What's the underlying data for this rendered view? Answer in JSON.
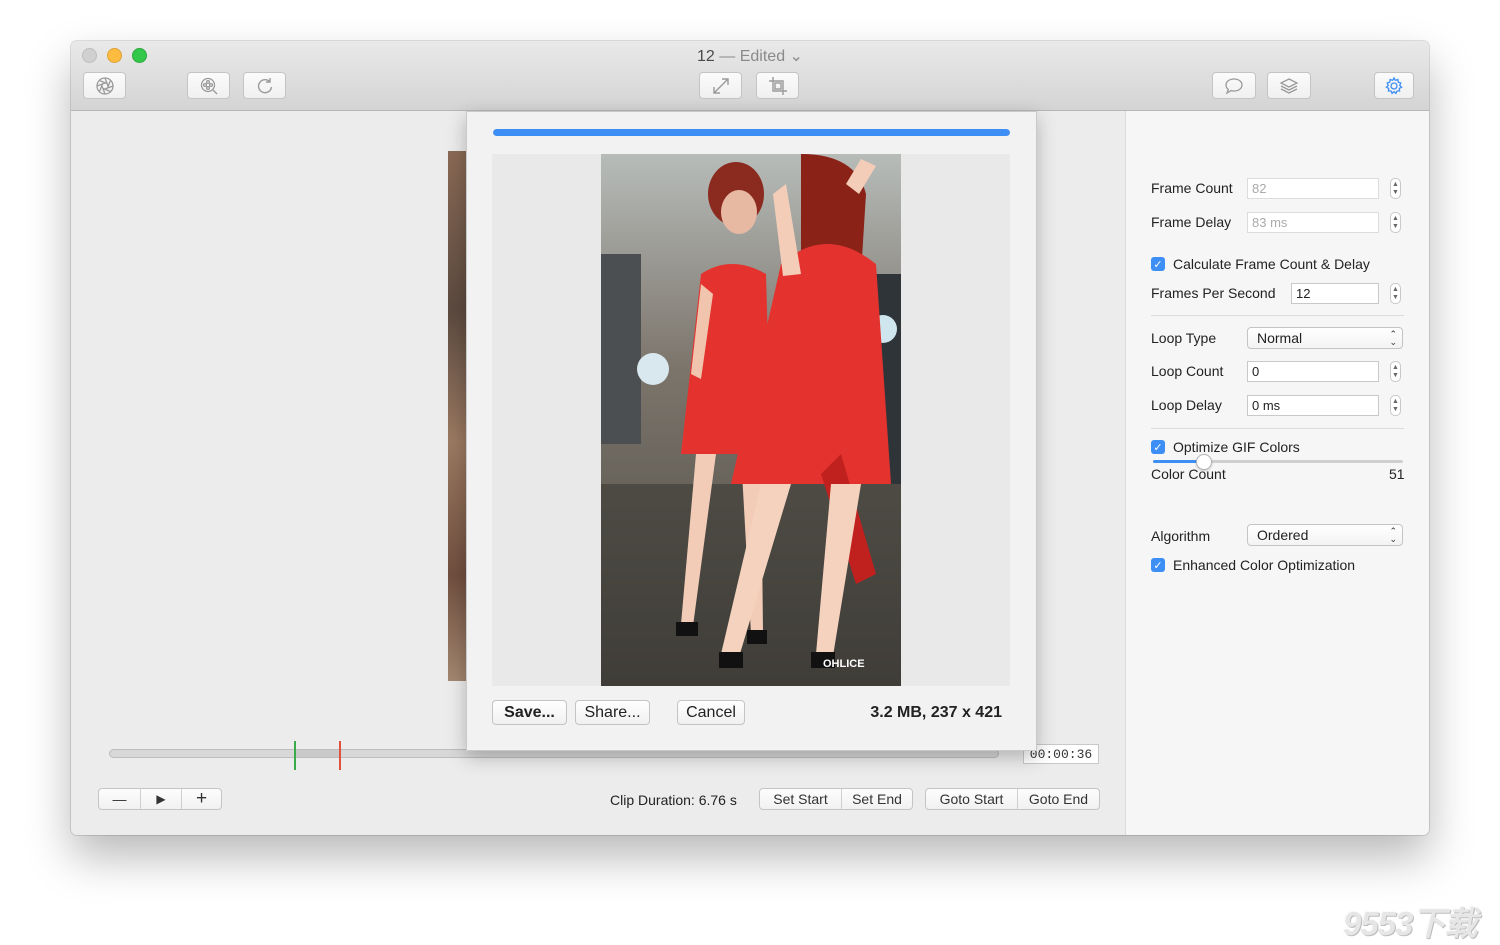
{
  "window": {
    "title": "12",
    "title_status": "— Edited",
    "title_chevron": "⌄"
  },
  "toolbar": {
    "icons": [
      "aperture-icon",
      "film-search-icon",
      "rotate-icon",
      "resize-icon",
      "crop-icon",
      "speech-bubble-icon",
      "layers-icon",
      "gear-icon"
    ]
  },
  "timeline": {
    "timecode": "00:00:36",
    "start_fraction": 0.207,
    "end_fraction": 0.257
  },
  "playback": {
    "minus": "—",
    "play": "▶",
    "plus": "+"
  },
  "clip": {
    "duration_text": "Clip Duration: 6.76 s",
    "set_start": "Set Start",
    "set_end": "Set End",
    "goto_start": "Goto Start",
    "goto_end": "Goto End"
  },
  "panel": {
    "frame_count_label": "Frame Count",
    "frame_count_value": "82",
    "frame_delay_label": "Frame Delay",
    "frame_delay_value": "83 ms",
    "calc_label": "Calculate Frame Count & Delay",
    "calc_checked": true,
    "fps_label": "Frames Per Second",
    "fps_value": "12",
    "loop_type_label": "Loop Type",
    "loop_type_value": "Normal",
    "loop_count_label": "Loop Count",
    "loop_count_value": "0",
    "loop_delay_label": "Loop Delay",
    "loop_delay_value": "0 ms",
    "optimize_label": "Optimize GIF Colors",
    "optimize_checked": true,
    "color_count_label": "Color Count",
    "color_count_value": "51",
    "color_slider_fraction": 0.2,
    "algorithm_label": "Algorithm",
    "algorithm_value": "Ordered",
    "enhanced_label": "Enhanced Color Optimization",
    "enhanced_checked": true
  },
  "sheet": {
    "progress_fraction": 1.0,
    "save_label": "Save...",
    "share_label": "Share...",
    "cancel_label": "Cancel",
    "info_text": "3.2 MB, 237 x 421",
    "photo_caption": "OHLICE"
  },
  "watermark": "9553下载",
  "colors": {
    "accent": "#3d8ef5",
    "start_marker": "#3aab4a",
    "end_marker": "#e0503a",
    "dress": "#e4332f"
  }
}
